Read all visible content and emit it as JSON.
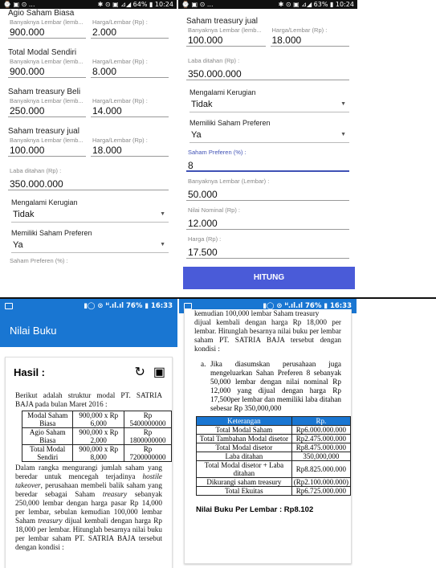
{
  "statusbar_top_left": {
    "icons": "⌚ ▣ ⊙ ...",
    "right": "✱ ⊙ ▣ ⊿◢ 64% ▮ 10:24"
  },
  "statusbar_top_right": {
    "icons": "⌚ ▣ ⊙ ...",
    "right": "✱ ⊙ ▣ ⊿◢ 63% ▮ 10:24"
  },
  "statusbar_bottom": {
    "right": "▮◯ ⊙ ᴴ.ıl.ıl 76% ▮ 16:33"
  },
  "labels": {
    "count": "Banyaknya Lembar (lemb...",
    "price": "Harga/Lembar (Rp) :",
    "laba": "Laba ditahan (Rp) :",
    "kerugian": "Mengalami Kerugian",
    "preferen": "Memiliki Saham Preferen",
    "pref_pct": "Saham Preferen (%) :",
    "lembar_full": "Banyaknya Lembar (Lembar) :",
    "nominal": "Nilai Nominal (Rp) :",
    "harga": "Harga (Rp) :"
  },
  "screen1": {
    "sections": [
      {
        "title": "Agio Saham Biasa",
        "count": "900.000",
        "price": "2.000"
      },
      {
        "title": "Total Modal Sendiri",
        "count": "900.000",
        "price": "8.000"
      },
      {
        "title": "Saham treasury Beli",
        "count": "250.000",
        "price": "14.000"
      },
      {
        "title": "Saham treasury jual",
        "count": "100.000",
        "price": "18.000"
      }
    ],
    "laba": "350.000.000",
    "kerugian": "Tidak",
    "preferen": "Ya"
  },
  "screen2": {
    "title": "Saham treasury jual",
    "count": "100.000",
    "price": "18.000",
    "laba": "350.000.000",
    "kerugian": "Tidak",
    "preferen": "Ya",
    "pref_pct": "8",
    "lembar": "50.000",
    "nominal": "12.000",
    "harga": "17.500",
    "button": "HITUNG"
  },
  "screen3": {
    "app_title": "Nilai Buku",
    "hasil": "Hasil :",
    "intro": "Berikut adalah struktur modal PT. SATRIA BAJA pada bulan Maret 2016 :",
    "table": [
      [
        "Modal Saham Biasa",
        "900,000 x Rp 6,000",
        "Rp 5400000000"
      ],
      [
        "Agio Saham Biasa",
        "900,000 x Rp 2,000",
        "Rp 1800000000"
      ],
      [
        "Total Modal Sendiri",
        "900,000 x Rp 8,000",
        "Rp 7200000000"
      ]
    ],
    "p1": "Dalam rangka mengurangi jumlah saham yang beredar untuk mencegah terjadinya",
    "p1_italic": "hostile takeover",
    "p1b": ", perusahaan membeli balik saham yang beredar sebagai Saham",
    "treasury": "treasury",
    "p1c": "sebanyak 250,000 lembar dengan harga pasar Rp 14,000 per lembar, sebulan kemudian 100,000 lembar Saham",
    "p1d": "dijual kembali dengan harga Rp 18,000 per lembar. Hitunglah besarnya nilai buku per lembar saham PT. SATRIA BAJA tersebut dengan kondisi :"
  },
  "screen4": {
    "top_cut": "kemudian 100,000 lembar Saham treasury",
    "p_top": "dijual kembali dengan harga Rp 18,000 per lembar. Hitunglah besarnya nilai buku per lembar saham PT. SATRIA BAJA tersebut dengan kondisi :",
    "item_letter": "a.",
    "item": "Jika diasumskan perusahaan juga mengeluarkan Sahan Preferen 8 sebanyak 50,000 lembar dengan nilai nominal Rp 12,000 yang dijual dengan harga Rp 17,500per lembar dan memiliki laba ditahan sebesar Rp 350,000,000",
    "headers": [
      "Keterangan",
      "Rp."
    ],
    "rows": [
      [
        "Total Modal Saham",
        "Rp6.000.000.000"
      ],
      [
        "Total Tambahan Modal disetor",
        "Rp2.475.000.000"
      ],
      [
        "Total Modal disetor",
        "Rp8.475.000.000"
      ],
      [
        "Laba ditahan",
        "350,000,000"
      ],
      [
        "Total Modal disetor + Laba ditahan",
        "Rp8.825.000.000"
      ],
      [
        "Dikurangi saham treasury",
        "(Rp2.100.000.000)"
      ],
      [
        "Total Ekuitas",
        "Rp6.725.000.000"
      ]
    ],
    "result": "Nilai Buku Per Lembar : Rp8.102"
  }
}
